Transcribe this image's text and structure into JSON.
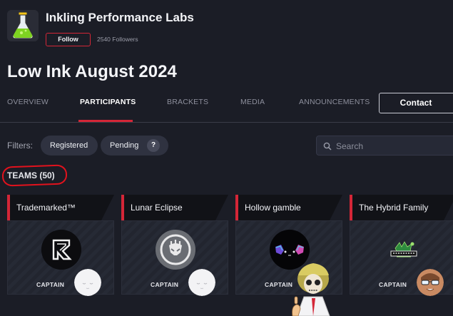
{
  "org": {
    "name": "Inkling Performance Labs",
    "follow_label": "Follow",
    "followers": "2540 Followers",
    "logo_icon": "flask-icon"
  },
  "event": {
    "title": "Low Ink August 2024"
  },
  "tabs": [
    {
      "label": "OVERVIEW",
      "active": false
    },
    {
      "label": "PARTICIPANTS",
      "active": true
    },
    {
      "label": "BRACKETS",
      "active": false
    },
    {
      "label": "MEDIA",
      "active": false
    },
    {
      "label": "ANNOUNCEMENTS",
      "active": false
    }
  ],
  "contact_label": "Contact",
  "filters": {
    "label": "Filters:",
    "registered": "Registered",
    "pending": "Pending",
    "help": "?"
  },
  "search": {
    "placeholder": "Search",
    "value": ""
  },
  "teams": {
    "title": "TEAMS (50)",
    "captain_label": "CAPTAIN",
    "items": [
      {
        "name": "Trademarked™",
        "logo_icon": "trademarked-logo-icon",
        "avatar_icon": "blank-face-avatar-icon"
      },
      {
        "name": "Lunar Eclipse",
        "logo_icon": "lunar-eclipse-logo-icon",
        "avatar_icon": "blank-face-avatar-icon"
      },
      {
        "name": "Hollow gamble",
        "logo_icon": "hollow-gamble-logo-icon",
        "avatar_icon": "none"
      },
      {
        "name": "The Hybrid Family",
        "logo_icon": "hybrid-family-logo-icon",
        "avatar_icon": "sunglasses-avatar-icon"
      }
    ]
  },
  "colors": {
    "background": "#1b1d26",
    "accent": "#d42637",
    "annotation": "#e2121d"
  }
}
